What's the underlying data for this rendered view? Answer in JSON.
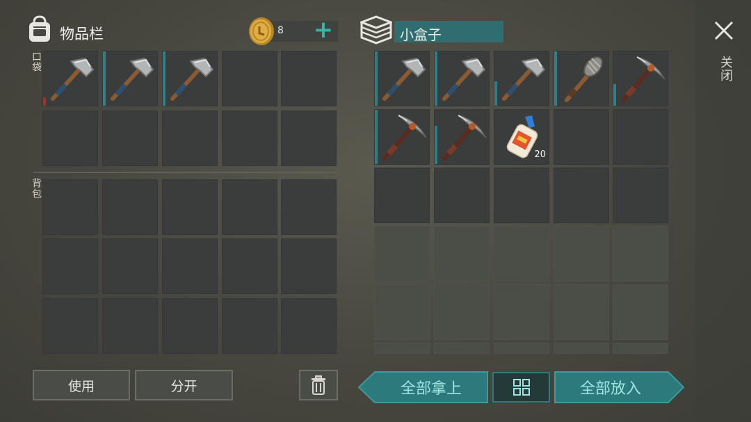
{
  "inventory": {
    "title": "物品栏",
    "coins": "8",
    "add_symbol": "+",
    "pocket_label": "口袋",
    "backpack_label": "背包",
    "pocket_items": [
      {
        "icon": "hammer-icon",
        "durability": 0.15,
        "durability_color": "#a3312a"
      },
      {
        "icon": "hammer-icon",
        "durability": 1.0,
        "durability_color": "#2f7f86"
      },
      {
        "icon": "hammer-icon",
        "durability": 1.0,
        "durability_color": "#2f7f86"
      }
    ],
    "use_button": "使用",
    "split_button": "分开"
  },
  "container": {
    "name": "小盒子",
    "items": [
      {
        "icon": "hammer-icon",
        "durability": 1.0
      },
      {
        "icon": "hammer-icon",
        "durability": 1.0
      },
      {
        "icon": "hammer-icon",
        "durability": 0.45
      },
      {
        "icon": "club-icon",
        "durability": 1.0
      },
      {
        "icon": "pickaxe-icon",
        "durability": 0.4
      },
      {
        "icon": "pickaxe-icon",
        "durability": 1.0
      },
      {
        "icon": "pickaxe-icon",
        "durability": 0.7
      },
      {
        "icon": "glue-icon",
        "quantity": "20"
      }
    ],
    "take_all_button": "全部拿上",
    "put_all_button": "全部放入"
  },
  "close_label": "关闭",
  "colors": {
    "accent": "#2d7a7c",
    "accent_text": "#9fe3e2",
    "coin": "#d9a43a",
    "durability_ok": "#2f7f86",
    "durability_low": "#a3312a"
  }
}
